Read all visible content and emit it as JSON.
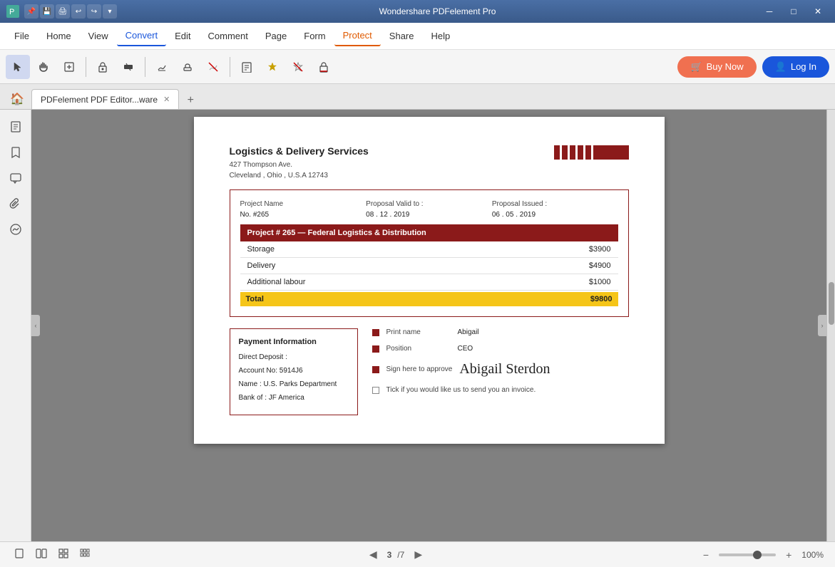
{
  "titleBar": {
    "title": "Wondershare PDFelement Pro",
    "icons": [
      "pin",
      "save",
      "print",
      "undo",
      "redo",
      "dropdown"
    ]
  },
  "menuBar": {
    "items": [
      {
        "label": "File",
        "active": false
      },
      {
        "label": "Home",
        "active": false
      },
      {
        "label": "View",
        "active": false
      },
      {
        "label": "Convert",
        "active": true
      },
      {
        "label": "Edit",
        "active": false
      },
      {
        "label": "Comment",
        "active": false
      },
      {
        "label": "Page",
        "active": false
      },
      {
        "label": "Form",
        "active": false
      },
      {
        "label": "Protect",
        "active": true,
        "protect": true
      },
      {
        "label": "Share",
        "active": false
      },
      {
        "label": "Help",
        "active": false
      }
    ]
  },
  "toolbar": {
    "buyLabel": "Buy Now",
    "loginLabel": "Log In"
  },
  "tabs": {
    "homeIcon": "🏠",
    "items": [
      {
        "label": "PDFelement",
        "subLabel": "PDF Editor...ware"
      }
    ],
    "addIcon": "+"
  },
  "sidebar": {
    "icons": [
      "pages",
      "bookmarks",
      "comments",
      "attachments",
      "signatures"
    ]
  },
  "document": {
    "company": "Logistics & Delivery Services",
    "addressLine1": "427 Thompson Ave.",
    "addressLine2": "Cleveland , Ohio , U.S.A 12743",
    "projectLabel": "Project Name",
    "proposalValidLabel": "Proposal Valid to :",
    "proposalIssuedLabel": "Proposal Issued :",
    "projectNo": "No. #265",
    "proposalValidDate": "08 . 12 . 2019",
    "proposalIssuedDate": "06 . 05 . 2019",
    "projectTitle": "Project # 265 — Federal Logistics & Distribution",
    "lineItems": [
      {
        "label": "Storage",
        "value": "$3900"
      },
      {
        "label": "Delivery",
        "value": "$4900"
      },
      {
        "label": "Additional labour",
        "value": "$1000"
      }
    ],
    "totalLabel": "Total",
    "totalValue": "$9800",
    "paymentTitle": "Payment Information",
    "paymentSubtitle": "Direct Deposit :",
    "paymentAccount": "Account No: 5914J6",
    "paymentName": "Name :  U.S. Parks Department",
    "paymentBank": "Bank of :  JF America",
    "printNameLabel": "Print name",
    "printNameValue": "Abigail",
    "positionLabel": "Position",
    "positionValue": "CEO",
    "signLabel": "Sign here to approve",
    "signValue": "Abigail Sterdon",
    "tickLabel": "Tick if you would like us to send you an invoice."
  },
  "statusBar": {
    "prevIcon": "◀",
    "nextIcon": "▶",
    "currentPage": "3",
    "totalPages": "/7",
    "zoomLevel": "100%",
    "zoomOutIcon": "−",
    "zoomInIcon": "+",
    "viewIcons": [
      "single",
      "double",
      "grid",
      "thumbnail"
    ]
  }
}
